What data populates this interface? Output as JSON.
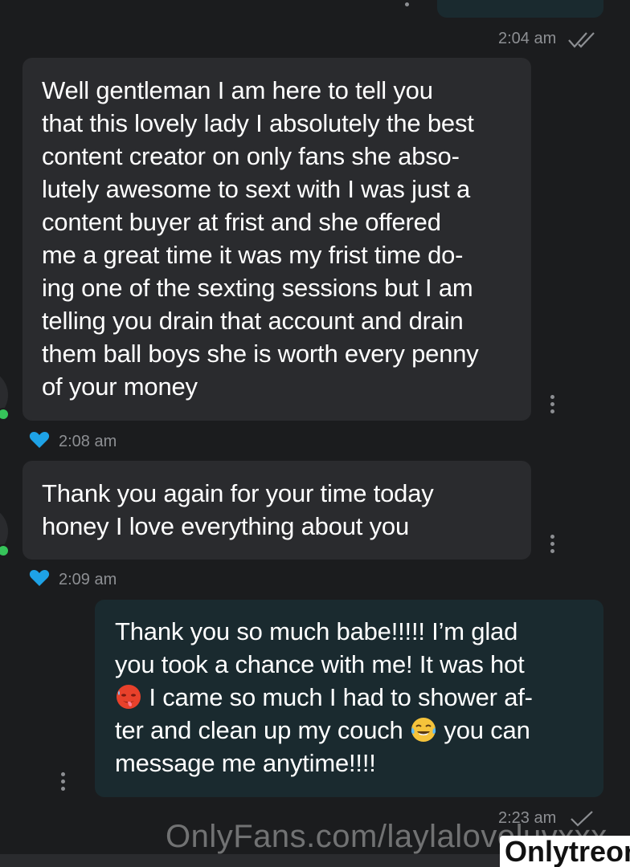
{
  "colors": {
    "background": "#1b1c1e",
    "incoming_bubble": "#2a2b2e",
    "outgoing_bubble": "#1a2a2f",
    "heart": "#1ea2e6",
    "timestamp": "#8d8f93"
  },
  "messages": [
    {
      "direction": "outgoing",
      "time": "2:04 am",
      "status_icon": "double-check-icon"
    },
    {
      "direction": "incoming",
      "text": "Well gentleman I am here to tell you\nthat this lovely lady I absolutely the best\ncontent creator on only fans she abso-\nlutely awesome to sext with I was just a\ncontent buyer at frist and she offered\nme a great time it was my frist time do-\ning one of the sexting sessions but I am\ntelling you drain that account and drain\nthem ball boys she is worth every penny\nof your money",
      "time": "2:08 am",
      "liked": true
    },
    {
      "direction": "incoming",
      "text": "Thank you again for your time today\nhoney I love everything about you",
      "time": "2:09 am",
      "liked": true
    },
    {
      "direction": "outgoing",
      "text_part1": "Thank you so much babe!!!!! I’m glad\nyou took a chance with me! It was hot\n",
      "emoji1": "hot-face-emoji",
      "text_part2": " I came so much I had to shower af-\nter and clean up my couch ",
      "emoji2": "tears-of-joy-emoji",
      "text_part3": " you can\nmessage me anytime!!!!",
      "time": "2:23 am",
      "status_icon": "single-check-icon"
    }
  ],
  "watermark": "OnlyFans.com/laylaloveluvxxx",
  "logo": "Onlytreon"
}
